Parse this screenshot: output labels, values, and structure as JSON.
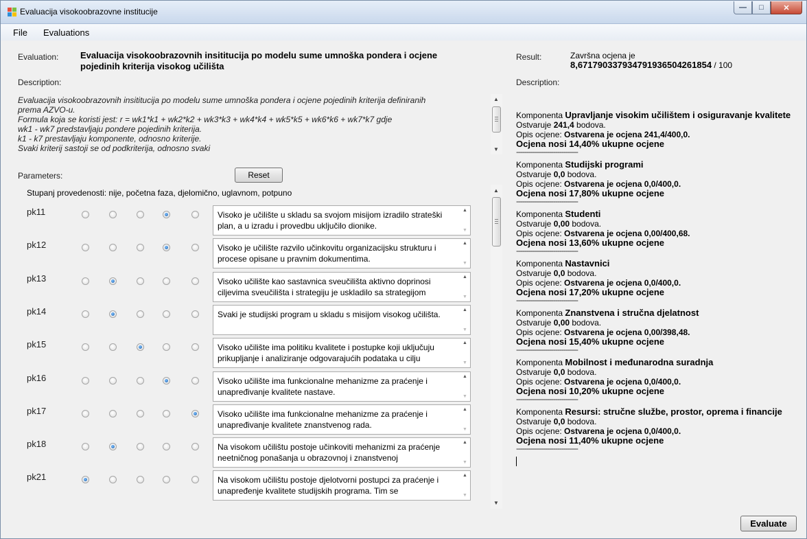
{
  "window": {
    "title": "Evaluacija visokoobrazovne institucije"
  },
  "menu": {
    "file": "File",
    "evaluations": "Evaluations"
  },
  "evaluation": {
    "label": "Evaluation:",
    "title": "Evaluacija visokoobrazovnih insititucija po modelu sume umnoška pondera i ocjene pojedinih kriterija visokog učilišta",
    "description_label": "Description:",
    "description_lines": [
      "Evaluacija visokoobrazovnih insititucija po modelu sume umnoška pondera i ocjene pojedinih kriterija definiranih",
      "prema AZVO-u.",
      "Formula koja se koristi jest: r = wk1*k1 + wk2*k2 + wk3*k3 + wk4*k4 + wk5*k5 + wk6*k6 + wk7*k7 gdje",
      "wk1 - wk7 predstavljaju pondere pojedinih kriterija.",
      "k1 - k7 prestavljaju komponente, odnosno kriterije.",
      "Svaki kriterij sastoji se od podkriterija, odnosno svaki"
    ]
  },
  "parameters": {
    "label": "Parameters:",
    "reset_label": "Reset",
    "scale_text": "Stupanj provedenosti: nije, početna faza, djelomično, uglavnom, potpuno",
    "rows": [
      {
        "name": "pk11",
        "selected": 4,
        "text": "Visoko je učilište u skladu sa svojom misijom izradilo strateški plan, a u izradu i provedbu uključilo dionike."
      },
      {
        "name": "pk12",
        "selected": 4,
        "text": "Visoko je učilište razvilo učinkovitu organizacijsku strukturu i procese opisane u pravnim dokumentima."
      },
      {
        "name": "pk13",
        "selected": 2,
        "text": "Visoko učilište kao sastavnica sveučilišta aktivno doprinosi ciljevima sveučilišta i strategiju je uskladilo sa strategijom"
      },
      {
        "name": "pk14",
        "selected": 2,
        "text": "Svaki je studijski program u skladu s misijom visokog učilišta."
      },
      {
        "name": "pk15",
        "selected": 3,
        "text": "Visoko učilište ima politiku kvalitete i postupke koji uključuju prikupljanje i analiziranje odgovarajućih podataka u cilju"
      },
      {
        "name": "pk16",
        "selected": 4,
        "text": "Visoko učilište ima funkcionalne mehanizme za praćenje i unapređivanje kvalitete nastave."
      },
      {
        "name": "pk17",
        "selected": 5,
        "text": "Visoko učilište ima funkcionalne mehanizme za praćenje i unapređivanje kvalitete znanstvenog rada."
      },
      {
        "name": "pk18",
        "selected": 2,
        "text": "Na visokom učilištu postoje učinkoviti mehanizmi za praćenje neetničnog ponašanja u obrazovnoj i znanstvenoj"
      },
      {
        "name": "pk21",
        "selected": 1,
        "text": "Na visokom učilištu postoje djelotvorni postupci za praćenje i unapređenje kvalitete studijskih programa. Tim se"
      }
    ]
  },
  "result": {
    "label": "Result:",
    "final_prefix": "Završna ocjena je",
    "final_value": "8,67179033793479193650426185­4",
    "final_suffix": " / 100",
    "description_label": "Description:",
    "components": [
      {
        "prefix": "Komponenta ",
        "name": "Upravljanje visokim učilištem i osiguravanje kvalitete",
        "points_prefix": "Ostvaruje ",
        "points": "241,4",
        "points_suffix": " bodova.",
        "opis_prefix": "Opis ocjene: ",
        "opis": "Ostvarena je ocjena 241,4/400,0.",
        "nosi": "Ocjena nosi 14,40% ukupne ocjene"
      },
      {
        "prefix": "Komponenta ",
        "name": "Studijski programi",
        "points_prefix": "Ostvaruje ",
        "points": "0,0",
        "points_suffix": " bodova.",
        "opis_prefix": "Opis ocjene: ",
        "opis": "Ostvarena je ocjena 0,0/400,0.",
        "nosi": "Ocjena nosi 17,80% ukupne ocjene"
      },
      {
        "prefix": "Komponenta ",
        "name": "Studenti",
        "points_prefix": "Ostvaruje ",
        "points": "0,00",
        "points_suffix": " bodova.",
        "opis_prefix": "Opis ocjene: ",
        "opis": "Ostvarena je ocjena 0,00/400,68.",
        "nosi": "Ocjena nosi 13,60% ukupne ocjene"
      },
      {
        "prefix": "Komponenta ",
        "name": "Nastavnici",
        "points_prefix": "Ostvaruje ",
        "points": "0,0",
        "points_suffix": " bodova.",
        "opis_prefix": "Opis ocjene: ",
        "opis": "Ostvarena je ocjena 0,0/400,0.",
        "nosi": "Ocjena nosi 17,20% ukupne ocjene"
      },
      {
        "prefix": "Komponenta ",
        "name": "Znanstvena i stručna djelatnost",
        "points_prefix": "Ostvaruje ",
        "points": "0,00",
        "points_suffix": " bodova.",
        "opis_prefix": "Opis ocjene: ",
        "opis": "Ostvarena je ocjena 0,00/398,48.",
        "nosi": "Ocjena nosi 15,40% ukupne ocjene"
      },
      {
        "prefix": "Komponenta ",
        "name": "Mobilnost i međunarodna suradnja",
        "points_prefix": "Ostvaruje ",
        "points": "0,0",
        "points_suffix": " bodova.",
        "opis_prefix": "Opis ocjene: ",
        "opis": "Ostvarena je ocjena 0,0/400,0.",
        "nosi": "Ocjena nosi 10,20% ukupne ocjene"
      },
      {
        "prefix": "Komponenta ",
        "name": "Resursi: stručne službe, prostor, oprema i financije",
        "points_prefix": "Ostvaruje ",
        "points": "0,0",
        "points_suffix": " bodova.",
        "opis_prefix": "Opis ocjene: ",
        "opis": "Ostvarena je ocjena 0,0/400,0.",
        "nosi": "Ocjena nosi 11,40% ukupne ocjene"
      }
    ],
    "separator": "------------------------------",
    "evaluate_label": "Evaluate"
  },
  "colors": {
    "selected_radio": "#1d5fa9",
    "title_bar": "#c9d8ec",
    "close_button": "#c74a35"
  }
}
